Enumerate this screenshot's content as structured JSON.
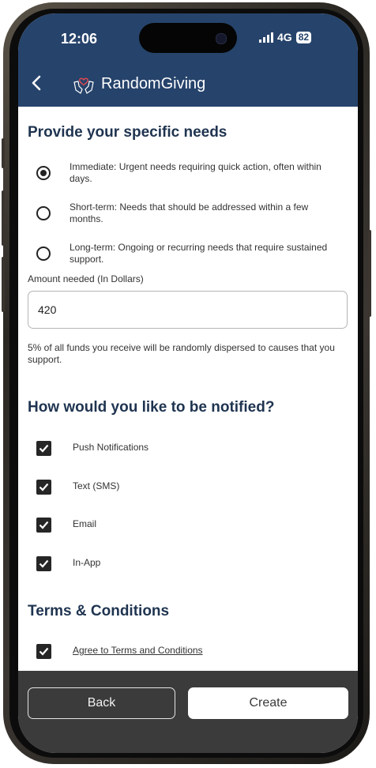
{
  "status_bar": {
    "time": "12:06",
    "network": "4G",
    "battery": "82"
  },
  "header": {
    "app_title": "RandomGiving",
    "back_icon": "chevron-left-icon",
    "logo_icon": "hands-heart-icon"
  },
  "needs": {
    "title": "Provide your specific needs",
    "options": [
      {
        "label": "Immediate: Urgent needs requiring quick action, often within days.",
        "selected": true
      },
      {
        "label": "Short-term: Needs that should be addressed within a few months.",
        "selected": false
      },
      {
        "label": "Long-term: Ongoing or recurring needs that require sustained support.",
        "selected": false
      }
    ]
  },
  "amount": {
    "label": "Amount needed (In Dollars)",
    "value": "420"
  },
  "note": "5% of all funds you receive will be randomly dispersed to causes that you support.",
  "notify": {
    "title": "How would you like to be notified?",
    "options": [
      {
        "label": "Push Notifications",
        "checked": true
      },
      {
        "label": "Text (SMS)",
        "checked": true
      },
      {
        "label": "Email",
        "checked": true
      },
      {
        "label": "In-App",
        "checked": true
      }
    ]
  },
  "terms": {
    "title": "Terms & Conditions",
    "label": "Agree to Terms and Conditions",
    "checked": true
  },
  "footer": {
    "back_label": "Back",
    "create_label": "Create"
  },
  "colors": {
    "header_bg": "#26436b",
    "heading_text": "#1f3450",
    "footer_bg": "#3b3b3b"
  }
}
